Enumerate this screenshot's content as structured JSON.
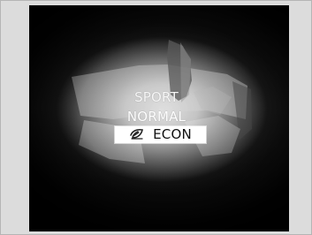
{
  "drive_modes": {
    "items": [
      {
        "label": "SPORT",
        "selected": false
      },
      {
        "label": "NORMAL",
        "selected": false
      },
      {
        "label": "ECON",
        "selected": true,
        "icon": "econ-leaf-icon"
      }
    ]
  },
  "colors": {
    "page_background": "#dcdcdc",
    "screen_dark": "#0b0b0b",
    "text_light": "#ffffff",
    "selected_background": "#ffffff",
    "selected_text": "#111111"
  }
}
